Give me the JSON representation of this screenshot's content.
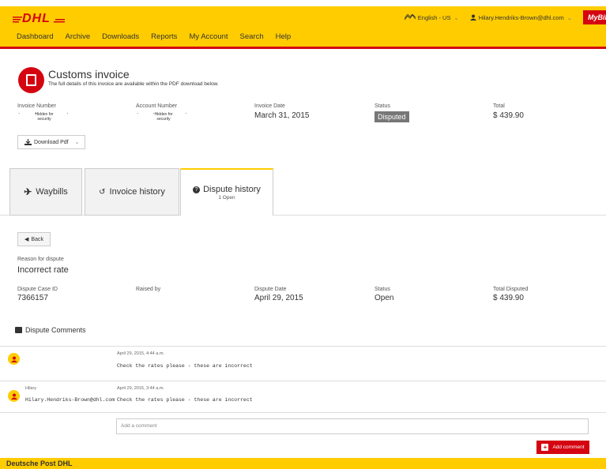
{
  "header": {
    "logo": "DHL",
    "language": "English - US",
    "user": "Hilary.Hendriks-Brown@dhl.com",
    "mybill": "MyBill",
    "nav": [
      "Dashboard",
      "Archive",
      "Downloads",
      "Reports",
      "My Account",
      "Search",
      "Help"
    ]
  },
  "invoice": {
    "title": "Customs invoice",
    "subtitle": "The full details of this invoice are available within the PDF download below.",
    "invoice_number_label": "Invoice Number",
    "invoice_number_value": "Hidden for security",
    "account_number_label": "Account Number",
    "account_number_value": "Hidden for security",
    "invoice_date_label": "Invoice Date",
    "invoice_date_value": "March 31, 2015",
    "status_label": "Status",
    "status_value": "Disputed",
    "total_label": "Total",
    "total_value": "$ 439.90",
    "download_label": "Download Pdf"
  },
  "tabs": [
    {
      "label": "Waybills",
      "sub": ""
    },
    {
      "label": "Invoice history",
      "sub": ""
    },
    {
      "label": "Dispute history",
      "sub": "1 Open"
    }
  ],
  "dispute": {
    "back_label": "Back",
    "reason_label": "Reason for dispute",
    "reason_value": "Incorrect rate",
    "case_id_label": "Dispute Case ID",
    "case_id_value": "7366157",
    "raised_by_label": "Raised by",
    "date_label": "Dispute Date",
    "date_value": "April 29, 2015",
    "status_label": "Status",
    "status_value": "Open",
    "total_label": "Total Disputed",
    "total_value": "$ 439.90"
  },
  "comments": {
    "title": "Dispute Comments",
    "items": [
      {
        "name": "",
        "email": "",
        "time": "April 29, 2015, 4:44 a.m.",
        "text": "Check the rates please - these are incorrect"
      },
      {
        "name": "Hilary",
        "email": "Hilary.Hendriks-Brown@dhl.com",
        "time": "April 29, 2015, 3:44 a.m.",
        "text": "Check the rates please - these are incorrect"
      }
    ],
    "placeholder": "Add a comment",
    "add_label": "Add comment"
  },
  "footer": {
    "label": "Deutsche Post DHL"
  },
  "colors": {
    "brand_yellow": "#ffcc00",
    "brand_red": "#d40511"
  }
}
